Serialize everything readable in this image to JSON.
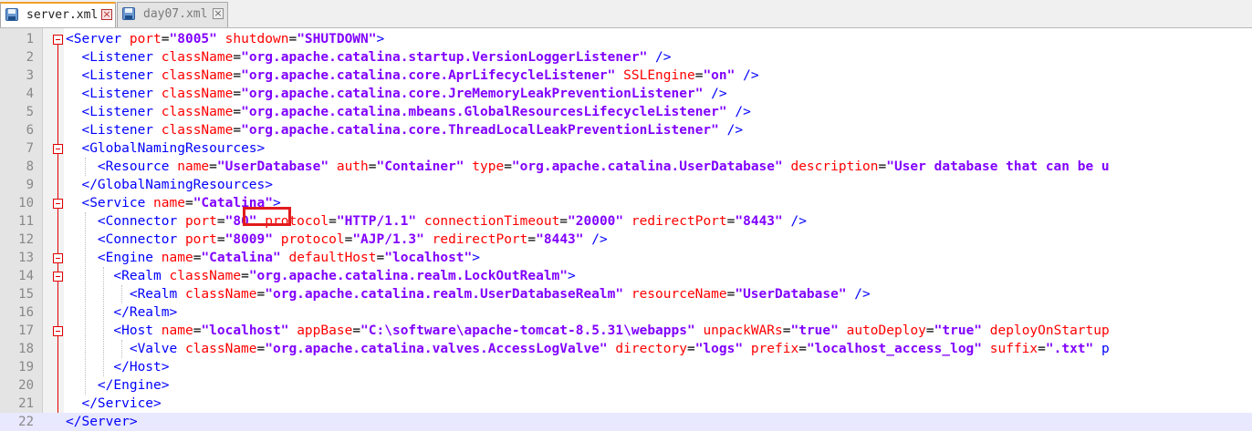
{
  "tabs": [
    {
      "label": "server.xml",
      "active": true
    },
    {
      "label": "day07.xml",
      "active": false
    }
  ],
  "editor": {
    "current_line": 22,
    "fold_markers": [
      1,
      7,
      10,
      13,
      14,
      17,
      22
    ],
    "lines": [
      [
        [
          "<Server ",
          "t"
        ],
        [
          "port",
          "a"
        ],
        [
          "=",
          "p"
        ],
        [
          "\"8005\"",
          "v"
        ],
        [
          " ",
          "p"
        ],
        [
          "shutdown",
          "a"
        ],
        [
          "=",
          "p"
        ],
        [
          "\"SHUTDOWN\"",
          "v"
        ],
        [
          ">",
          "t"
        ]
      ],
      [
        [
          "  "
        ],
        [
          "<Listener ",
          "t"
        ],
        [
          "className",
          "a"
        ],
        [
          "=",
          "p"
        ],
        [
          "\"org.apache.catalina.startup.VersionLoggerListener\"",
          "v"
        ],
        [
          " />",
          "t"
        ]
      ],
      [
        [
          "  "
        ],
        [
          "<Listener ",
          "t"
        ],
        [
          "className",
          "a"
        ],
        [
          "=",
          "p"
        ],
        [
          "\"org.apache.catalina.core.AprLifecycleListener\"",
          "v"
        ],
        [
          " ",
          "p"
        ],
        [
          "SSLEngine",
          "a"
        ],
        [
          "=",
          "p"
        ],
        [
          "\"on\"",
          "v"
        ],
        [
          " />",
          "t"
        ]
      ],
      [
        [
          "  "
        ],
        [
          "<Listener ",
          "t"
        ],
        [
          "className",
          "a"
        ],
        [
          "=",
          "p"
        ],
        [
          "\"org.apache.catalina.core.JreMemoryLeakPreventionListener\"",
          "v"
        ],
        [
          " />",
          "t"
        ]
      ],
      [
        [
          "  "
        ],
        [
          "<Listener ",
          "t"
        ],
        [
          "className",
          "a"
        ],
        [
          "=",
          "p"
        ],
        [
          "\"org.apache.catalina.mbeans.GlobalResourcesLifecycleListener\"",
          "v"
        ],
        [
          " />",
          "t"
        ]
      ],
      [
        [
          "  "
        ],
        [
          "<Listener ",
          "t"
        ],
        [
          "className",
          "a"
        ],
        [
          "=",
          "p"
        ],
        [
          "\"org.apache.catalina.core.ThreadLocalLeakPreventionListener\"",
          "v"
        ],
        [
          " />",
          "t"
        ]
      ],
      [
        [
          "  "
        ],
        [
          "<GlobalNamingResources>",
          "t"
        ]
      ],
      [
        [
          "    "
        ],
        [
          "<Resource ",
          "t"
        ],
        [
          "name",
          "a"
        ],
        [
          "=",
          "p"
        ],
        [
          "\"UserDatabase\"",
          "v"
        ],
        [
          " ",
          "p"
        ],
        [
          "auth",
          "a"
        ],
        [
          "=",
          "p"
        ],
        [
          "\"Container\"",
          "v"
        ],
        [
          " ",
          "p"
        ],
        [
          "type",
          "a"
        ],
        [
          "=",
          "p"
        ],
        [
          "\"org.apache.catalina.UserDatabase\"",
          "v"
        ],
        [
          " ",
          "p"
        ],
        [
          "description",
          "a"
        ],
        [
          "=",
          "p"
        ],
        [
          "\"User database that can be u",
          "v"
        ]
      ],
      [
        [
          "  "
        ],
        [
          "</GlobalNamingResources>",
          "t"
        ]
      ],
      [
        [
          "  "
        ],
        [
          "<Service ",
          "t"
        ],
        [
          "name",
          "a"
        ],
        [
          "=",
          "p"
        ],
        [
          "\"Catalina\"",
          "v"
        ],
        [
          ">",
          "t"
        ]
      ],
      [
        [
          "    "
        ],
        [
          "<Connector ",
          "t"
        ],
        [
          "port",
          "a"
        ],
        [
          "=",
          "p"
        ],
        [
          "\"80\"",
          "v"
        ],
        [
          " ",
          "p"
        ],
        [
          "protocol",
          "a"
        ],
        [
          "=",
          "p"
        ],
        [
          "\"HTTP/1.1\"",
          "v"
        ],
        [
          " ",
          "p"
        ],
        [
          "connectionTimeout",
          "a"
        ],
        [
          "=",
          "p"
        ],
        [
          "\"20000\"",
          "v"
        ],
        [
          " ",
          "p"
        ],
        [
          "redirectPort",
          "a"
        ],
        [
          "=",
          "p"
        ],
        [
          "\"8443\"",
          "v"
        ],
        [
          " />",
          "t"
        ]
      ],
      [
        [
          "    "
        ],
        [
          "<Connector ",
          "t"
        ],
        [
          "port",
          "a"
        ],
        [
          "=",
          "p"
        ],
        [
          "\"8009\"",
          "v"
        ],
        [
          " ",
          "p"
        ],
        [
          "protocol",
          "a"
        ],
        [
          "=",
          "p"
        ],
        [
          "\"AJP/1.3\"",
          "v"
        ],
        [
          " ",
          "p"
        ],
        [
          "redirectPort",
          "a"
        ],
        [
          "=",
          "p"
        ],
        [
          "\"8443\"",
          "v"
        ],
        [
          " />",
          "t"
        ]
      ],
      [
        [
          "    "
        ],
        [
          "<Engine ",
          "t"
        ],
        [
          "name",
          "a"
        ],
        [
          "=",
          "p"
        ],
        [
          "\"Catalina\"",
          "v"
        ],
        [
          " ",
          "p"
        ],
        [
          "defaultHost",
          "a"
        ],
        [
          "=",
          "p"
        ],
        [
          "\"localhost\"",
          "v"
        ],
        [
          ">",
          "t"
        ]
      ],
      [
        [
          "      "
        ],
        [
          "<Realm ",
          "t"
        ],
        [
          "className",
          "a"
        ],
        [
          "=",
          "p"
        ],
        [
          "\"org.apache.catalina.realm.LockOutRealm\"",
          "v"
        ],
        [
          ">",
          "t"
        ]
      ],
      [
        [
          "        "
        ],
        [
          "<Realm ",
          "t"
        ],
        [
          "className",
          "a"
        ],
        [
          "=",
          "p"
        ],
        [
          "\"org.apache.catalina.realm.UserDatabaseRealm\"",
          "v"
        ],
        [
          " ",
          "p"
        ],
        [
          "resourceName",
          "a"
        ],
        [
          "=",
          "p"
        ],
        [
          "\"UserDatabase\"",
          "v"
        ],
        [
          " />",
          "t"
        ]
      ],
      [
        [
          "      "
        ],
        [
          "</Realm>",
          "t"
        ]
      ],
      [
        [
          "      "
        ],
        [
          "<Host ",
          "t"
        ],
        [
          "name",
          "a"
        ],
        [
          "=",
          "p"
        ],
        [
          "\"localhost\"",
          "v"
        ],
        [
          " ",
          "p"
        ],
        [
          "appBase",
          "a"
        ],
        [
          "=",
          "p"
        ],
        [
          "\"C:\\software\\apache-tomcat-8.5.31\\webapps\"",
          "v"
        ],
        [
          " ",
          "p"
        ],
        [
          "unpackWARs",
          "a"
        ],
        [
          "=",
          "p"
        ],
        [
          "\"true\"",
          "v"
        ],
        [
          " ",
          "p"
        ],
        [
          "autoDeploy",
          "a"
        ],
        [
          "=",
          "p"
        ],
        [
          "\"true\"",
          "v"
        ],
        [
          " ",
          "p"
        ],
        [
          "deployOnStartup",
          "a"
        ]
      ],
      [
        [
          "        "
        ],
        [
          "<Valve ",
          "t"
        ],
        [
          "className",
          "a"
        ],
        [
          "=",
          "p"
        ],
        [
          "\"org.apache.catalina.valves.AccessLogValve\"",
          "v"
        ],
        [
          " ",
          "p"
        ],
        [
          "directory",
          "a"
        ],
        [
          "=",
          "p"
        ],
        [
          "\"logs\"",
          "v"
        ],
        [
          " ",
          "p"
        ],
        [
          "prefix",
          "a"
        ],
        [
          "=",
          "p"
        ],
        [
          "\"localhost_access_log\"",
          "v"
        ],
        [
          " ",
          "p"
        ],
        [
          "suffix",
          "a"
        ],
        [
          "=",
          "p"
        ],
        [
          "\".txt\"",
          "v"
        ],
        [
          " p",
          "t"
        ]
      ],
      [
        [
          "      "
        ],
        [
          "</Host>",
          "t"
        ]
      ],
      [
        [
          "    "
        ],
        [
          "</Engine>",
          "t"
        ]
      ],
      [
        [
          "  "
        ],
        [
          "</Service>",
          "t"
        ]
      ],
      [
        [
          "</Server>",
          "t"
        ]
      ]
    ]
  },
  "colors": {
    "t": "#0000ff",
    "a": "#ff0000",
    "v": "#8000ff",
    "p": "#000000",
    "highlight": "#e21b1b"
  }
}
